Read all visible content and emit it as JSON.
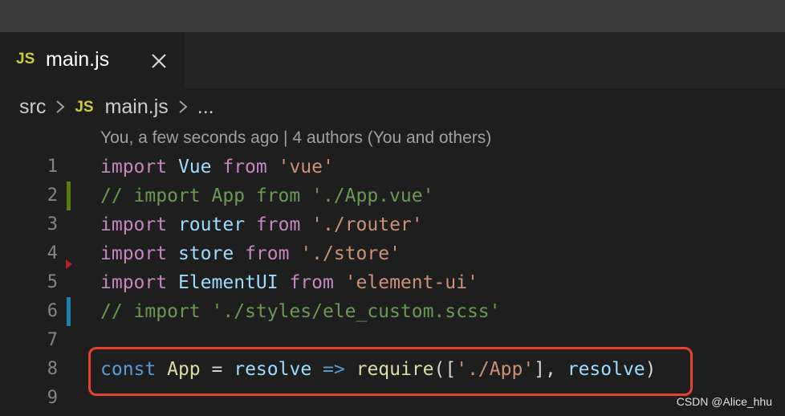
{
  "tab": {
    "icon_label": "JS",
    "title": "main.js"
  },
  "breadcrumb": {
    "folder": "src",
    "icon_label": "JS",
    "file": "main.js",
    "ellipsis": "..."
  },
  "blame": "You, a few seconds ago | 4 authors (You and others)",
  "lines": [
    {
      "number": "1"
    },
    {
      "number": "2"
    },
    {
      "number": "3"
    },
    {
      "number": "4"
    },
    {
      "number": "5"
    },
    {
      "number": "6"
    },
    {
      "number": "7"
    },
    {
      "number": "8"
    },
    {
      "number": "9"
    }
  ],
  "code": {
    "l1": {
      "kw": "import",
      "id": "Vue",
      "kw2": "from",
      "str": "'vue'"
    },
    "l2": {
      "comment": "// import App from './App.vue'"
    },
    "l3": {
      "kw": "import",
      "id": "router",
      "kw2": "from",
      "str": "'./router'"
    },
    "l4": {
      "kw": "import",
      "id": "store",
      "kw2": "from",
      "str": "'./store'"
    },
    "l5": {
      "kw": "import",
      "id": "ElementUI",
      "kw2": "from",
      "str": "'element-ui'"
    },
    "l6": {
      "comment": "// import './styles/ele_custom.scss'"
    },
    "l8": {
      "const": "const",
      "name": "App",
      "eq": "=",
      "param": "resolve",
      "arrow": "=>",
      "fn": "require",
      "open": "([",
      "str": "'./App'",
      "close": "], ",
      "arg": "resolve",
      "end": ")"
    }
  },
  "watermark": "CSDN @Alice_hhu",
  "colors": {
    "gutter_modified_line2": "#587c0c",
    "gutter_modified_line6": "#1b81a8",
    "gutter_deleted_line4": "#b0232a",
    "highlight_box": "#e5422d"
  },
  "icons": [
    "js-file-icon",
    "close-icon",
    "chevron-right-icon"
  ]
}
